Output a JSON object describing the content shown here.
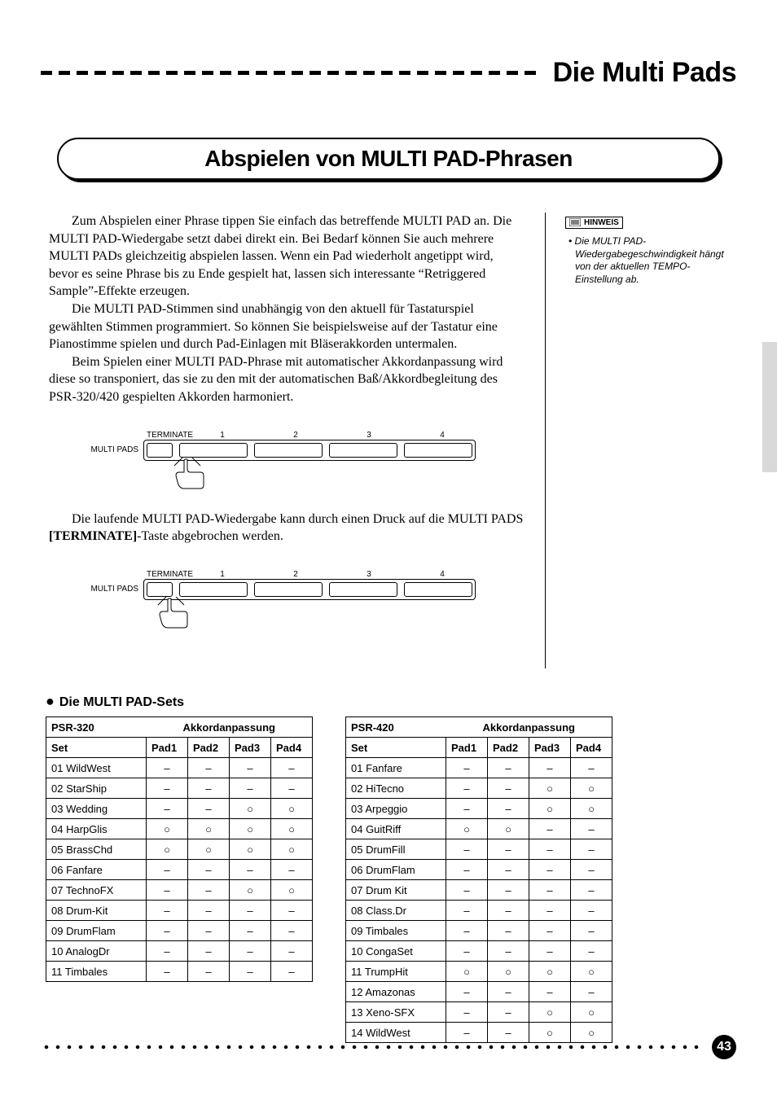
{
  "header": {
    "title": "Die Multi Pads"
  },
  "section": {
    "title": "Abspielen von MULTI PAD-Phrasen"
  },
  "paragraphs": {
    "p1": "Zum Abspielen einer Phrase tippen Sie einfach das betreffende MULTI PAD an. Die MULTI PAD-Wiedergabe setzt dabei direkt ein. Bei Bedarf können Sie auch mehrere MULTI PADs gleichzeitig abspielen lassen. Wenn ein Pad wiederholt angetippt wird, bevor es seine Phrase bis zu Ende gespielt hat, lassen sich interessante “Retriggered Sample”-Effekte erzeugen.",
    "p2": "Die MULTI PAD-Stimmen sind unabhängig von den aktuell für Tastaturspiel gewählten Stimmen programmiert. So können Sie beispielsweise auf der Tastatur eine Pianostimme spielen und durch Pad-Einlagen mit Bläserakkorden untermalen.",
    "p3": "Beim Spielen einer MULTI PAD-Phrase mit automatischer Akkordanpassung wird diese so transponiert, das sie zu den mit der automatischen Baß/Akkordbegleitung des PSR-320/420 gespielten Akkorden harmoniert.",
    "p4a": "Die laufende MULTI PAD-Wiedergabe kann durch einen Druck auf die MULTI PADS ",
    "p4b": "[TERMINATE]",
    "p4c": "-Taste abgebrochen werden."
  },
  "hinweis": {
    "label": "HINWEIS",
    "text": "Die MULTI PAD-Wiedergabegeschwindigkeit hängt von der aktuellen TEMPO-Einstellung ab."
  },
  "diagram": {
    "row_label": "MULTI PADS",
    "terminate": "TERMINATE",
    "nums": [
      "1",
      "2",
      "3",
      "4"
    ]
  },
  "subsection": "Die MULTI PAD-Sets",
  "table_headers": {
    "akk": "Akkordanpassung",
    "set": "Set",
    "pad1": "Pad1",
    "pad2": "Pad2",
    "pad3": "Pad3",
    "pad4": "Pad4"
  },
  "table320": {
    "model": "PSR-320",
    "rows": [
      {
        "set": "01 WildWest",
        "p": [
          "–",
          "–",
          "–",
          "–"
        ]
      },
      {
        "set": "02 StarShip",
        "p": [
          "–",
          "–",
          "–",
          "–"
        ]
      },
      {
        "set": "03 Wedding",
        "p": [
          "–",
          "–",
          "O",
          "O"
        ]
      },
      {
        "set": "04 HarpGlis",
        "p": [
          "O",
          "O",
          "O",
          "O"
        ]
      },
      {
        "set": "05 BrassChd",
        "p": [
          "O",
          "O",
          "O",
          "O"
        ]
      },
      {
        "set": "06 Fanfare",
        "p": [
          "–",
          "–",
          "–",
          "–"
        ]
      },
      {
        "set": "07 TechnoFX",
        "p": [
          "–",
          "–",
          "O",
          "O"
        ]
      },
      {
        "set": "08 Drum-Kit",
        "p": [
          "–",
          "–",
          "–",
          "–"
        ]
      },
      {
        "set": "09 DrumFlam",
        "p": [
          "–",
          "–",
          "–",
          "–"
        ]
      },
      {
        "set": "10 AnalogDr",
        "p": [
          "–",
          "–",
          "–",
          "–"
        ]
      },
      {
        "set": "11 Timbales",
        "p": [
          "–",
          "–",
          "–",
          "–"
        ]
      }
    ]
  },
  "table420": {
    "model": "PSR-420",
    "rows": [
      {
        "set": "01 Fanfare",
        "p": [
          "–",
          "–",
          "–",
          "–"
        ]
      },
      {
        "set": "02 HiTecno",
        "p": [
          "–",
          "–",
          "O",
          "O"
        ]
      },
      {
        "set": "03 Arpeggio",
        "p": [
          "–",
          "–",
          "O",
          "O"
        ]
      },
      {
        "set": "04 GuitRiff",
        "p": [
          "O",
          "O",
          "–",
          "–"
        ]
      },
      {
        "set": "05 DrumFill",
        "p": [
          "–",
          "–",
          "–",
          "–"
        ]
      },
      {
        "set": "06 DrumFlam",
        "p": [
          "–",
          "–",
          "–",
          "–"
        ]
      },
      {
        "set": "07 Drum Kit",
        "p": [
          "–",
          "–",
          "–",
          "–"
        ]
      },
      {
        "set": "08 Class.Dr",
        "p": [
          "–",
          "–",
          "–",
          "–"
        ]
      },
      {
        "set": "09 Timbales",
        "p": [
          "–",
          "–",
          "–",
          "–"
        ]
      },
      {
        "set": "10 CongaSet",
        "p": [
          "–",
          "–",
          "–",
          "–"
        ]
      },
      {
        "set": "11 TrumpHit",
        "p": [
          "O",
          "O",
          "O",
          "O"
        ]
      },
      {
        "set": "12 Amazonas",
        "p": [
          "–",
          "–",
          "–",
          "–"
        ]
      },
      {
        "set": "13 Xeno-SFX",
        "p": [
          "–",
          "–",
          "O",
          "O"
        ]
      },
      {
        "set": "14 WildWest",
        "p": [
          "–",
          "–",
          "O",
          "O"
        ]
      }
    ]
  },
  "page_number": "43"
}
